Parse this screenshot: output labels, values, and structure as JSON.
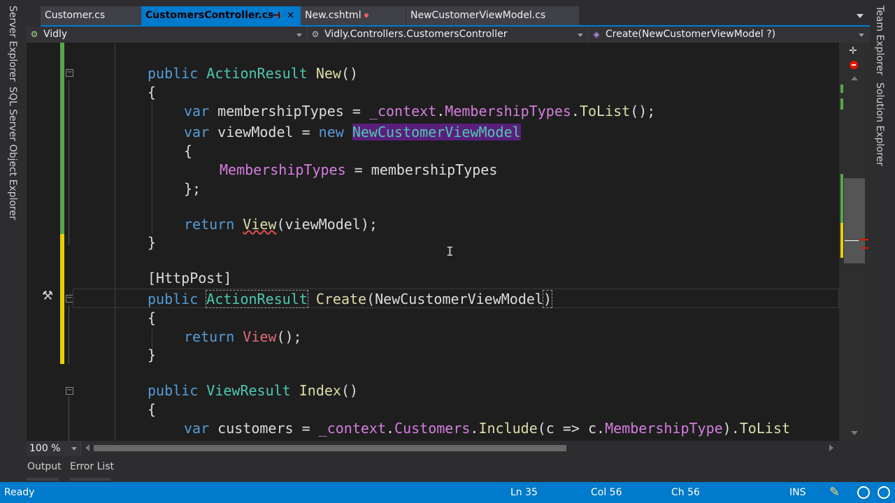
{
  "left_panel": {
    "tabs": [
      "Server Explorer",
      "SQL Server Object Explorer"
    ]
  },
  "right_panel": {
    "tabs": [
      "Team Explorer",
      "Solution Explorer"
    ]
  },
  "tabs": [
    {
      "label": "Customer.cs"
    },
    {
      "label": "CustomersController.cs",
      "pin": "⊣",
      "close": "✕"
    },
    {
      "label": "New.cshtml"
    },
    {
      "label": "NewCustomerViewModel.cs"
    }
  ],
  "navbar": {
    "project": "Vidly",
    "class": "Vidly.Controllers.CustomersController",
    "member": "Create(NewCustomerViewModel ?)"
  },
  "icons": {
    "project": "csharp-project-icon",
    "class": "class-icon",
    "method": "method-icon",
    "quick_actions": "screwdriver-icon",
    "split": "split-window-icon",
    "error": "error-icon",
    "pencil": "pencil-icon",
    "notifications": "notification-icon"
  },
  "code": {
    "l1": {
      "a": "public ",
      "b": "ActionResult ",
      "c": "New",
      "d": "()"
    },
    "l2": "{",
    "l3": {
      "a": "var ",
      "b": "membershipTypes = ",
      "c": "_context",
      "d": ".",
      "e": "MembershipTypes",
      "f": ".",
      "g": "ToList",
      "h": "();"
    },
    "l4": {
      "a": "var ",
      "b": "viewModel = ",
      "c": "new ",
      "d": "NewCustomerViewModel"
    },
    "l5": "{",
    "l6": {
      "a": "MembershipTypes",
      "b": " = membershipTypes"
    },
    "l7": "};",
    "l8": {
      "a": "return ",
      "b": "View",
      "c": "(viewModel);"
    },
    "l9": "}",
    "l10": "[HttpPost]",
    "l11": {
      "a": "public ",
      "b": "ActionResult",
      "c": " ",
      "d": "Create",
      "e": "(NewCustomerViewModel",
      "f": ")"
    },
    "l12": "{",
    "l13": {
      "a": "return ",
      "b": "View",
      "c": "();"
    },
    "l14": "}",
    "l15": {
      "a": "public ",
      "b": "ViewResult ",
      "c": "Index",
      "d": "()"
    },
    "l16": "{",
    "l17": {
      "a": "var ",
      "b": "customers = ",
      "c": "_context",
      "d": ".",
      "e": "Customers",
      "f": ".",
      "g": "Include",
      "h": "(c => c.",
      "i": "MembershipType",
      "j": ").",
      "k": "ToList"
    }
  },
  "zoom": "100 %",
  "bottom_tabs": [
    "Output",
    "Error List"
  ],
  "status": {
    "state": "Ready",
    "line": "Ln 35",
    "col": "Col 56",
    "ch": "Ch 56",
    "mode": "INS"
  },
  "colors": {
    "keyword": "#569cd6",
    "type": "#4ec9b0",
    "property": "#d67ee0",
    "method": "#dcdcaa",
    "accent": "#007acc"
  }
}
